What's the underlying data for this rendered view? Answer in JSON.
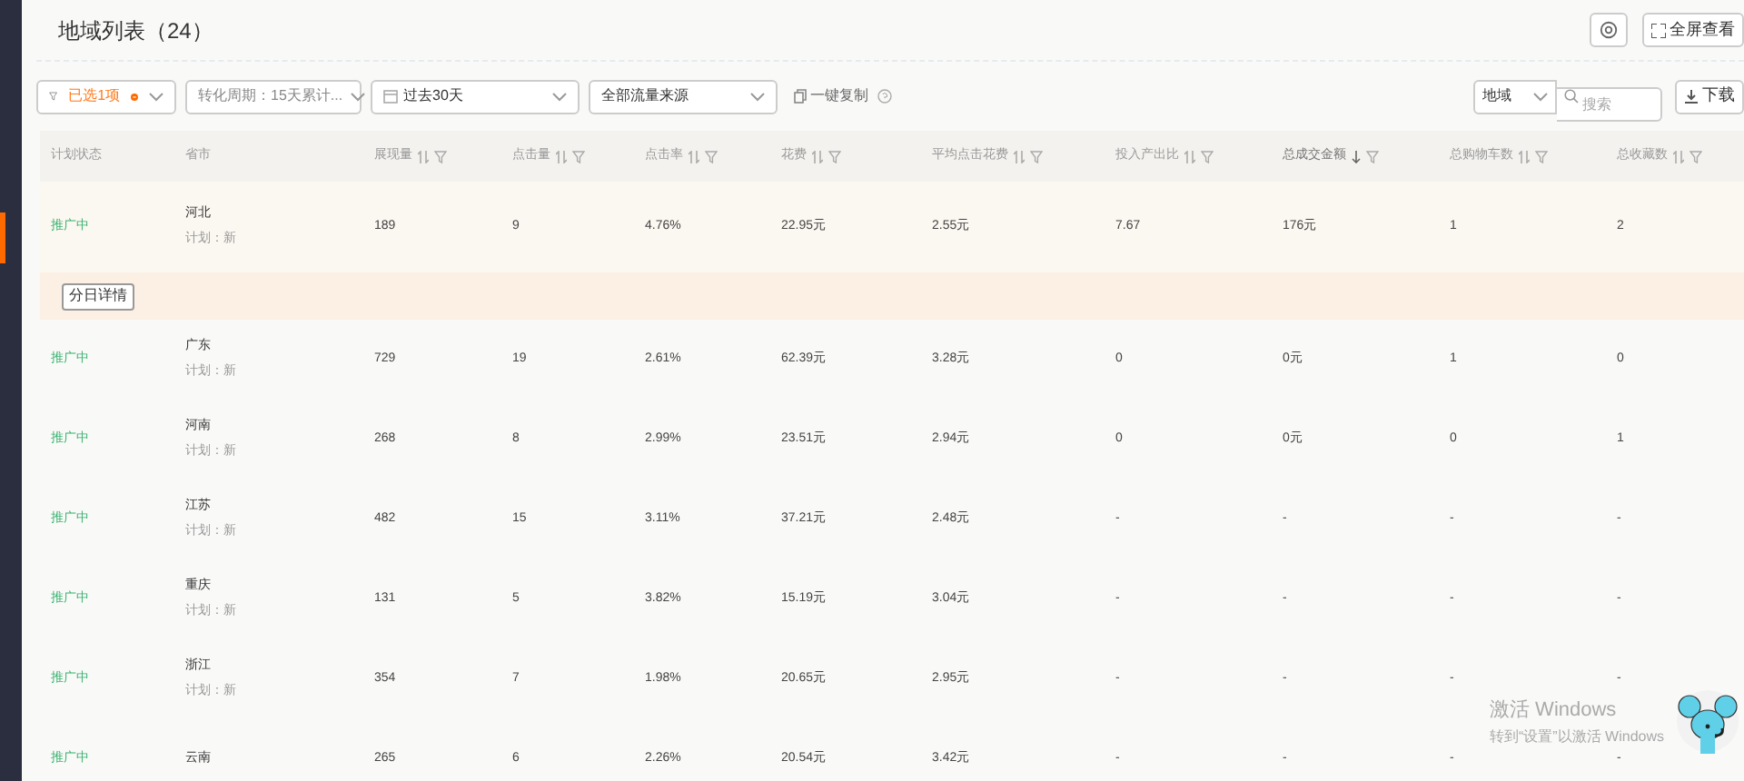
{
  "title": "地域列表（24）",
  "toolbar": {
    "fullscreen": "全屏查看",
    "download": "下载",
    "region_select": "地域",
    "search": {
      "placeholder": "搜索"
    }
  },
  "filters": [
    {
      "kind": "filter",
      "label": "已选1项",
      "badge": true
    },
    {
      "kind": "select",
      "label": "转化周期：15天累计..."
    },
    {
      "kind": "date",
      "label": "过去30天"
    },
    {
      "kind": "select",
      "label": "全部流量来源"
    },
    {
      "kind": "copy",
      "label": "一键复制"
    }
  ],
  "columns": [
    {
      "label": "计划状态",
      "sortable": false,
      "sorted_descending": false,
      "filter": false
    },
    {
      "label": "省市",
      "sortable": false,
      "sorted_descending": false,
      "filter": false
    },
    {
      "label": "展现量",
      "sortable": true,
      "sorted_descending": false,
      "filter": true
    },
    {
      "label": "点击量",
      "sortable": true,
      "sorted_descending": false,
      "filter": true
    },
    {
      "label": "点击率",
      "sortable": true,
      "sorted_descending": false,
      "filter": true
    },
    {
      "label": "花费",
      "sortable": true,
      "sorted_descending": false,
      "filter": true
    },
    {
      "label": "平均点击花费",
      "sortable": true,
      "sorted_descending": false,
      "filter": true
    },
    {
      "label": "投入产出比",
      "sortable": true,
      "sorted_descending": false,
      "filter": true
    },
    {
      "label": "总成交金额",
      "sortable": true,
      "sorted_descending": true,
      "filter": true
    },
    {
      "label": "总购物车数",
      "sortable": true,
      "sorted_descending": false,
      "filter": true
    },
    {
      "label": "总收藏数",
      "sortable": true,
      "sorted_descending": false,
      "filter": true
    }
  ],
  "rows": [
    {
      "status": "推广中",
      "region": "河北",
      "plan": "计划：新",
      "cells": [
        "189",
        "9",
        "4.76%",
        "22.95元",
        "2.55元",
        "7.67",
        "176元",
        "1",
        "2"
      ],
      "selected": true,
      "expanded": true,
      "detail_button": "分日详情"
    },
    {
      "status": "推广中",
      "region": "广东",
      "plan": "计划：新",
      "cells": [
        "729",
        "19",
        "2.61%",
        "62.39元",
        "3.28元",
        "0",
        "0元",
        "1",
        "0"
      ],
      "selected": false,
      "expanded": false
    },
    {
      "status": "推广中",
      "region": "河南",
      "plan": "计划：新",
      "cells": [
        "268",
        "8",
        "2.99%",
        "23.51元",
        "2.94元",
        "0",
        "0元",
        "0",
        "1"
      ],
      "selected": false,
      "expanded": false
    },
    {
      "status": "推广中",
      "region": "江苏",
      "plan": "计划：新",
      "cells": [
        "482",
        "15",
        "3.11%",
        "37.21元",
        "2.48元",
        "-",
        "-",
        "-",
        "-"
      ],
      "selected": false,
      "expanded": false
    },
    {
      "status": "推广中",
      "region": "重庆",
      "plan": "计划：新",
      "cells": [
        "131",
        "5",
        "3.82%",
        "15.19元",
        "3.04元",
        "-",
        "-",
        "-",
        "-"
      ],
      "selected": false,
      "expanded": false
    },
    {
      "status": "推广中",
      "region": "浙江",
      "plan": "计划：新",
      "cells": [
        "354",
        "7",
        "1.98%",
        "20.65元",
        "2.95元",
        "-",
        "-",
        "-",
        "-"
      ],
      "selected": false,
      "expanded": false
    },
    {
      "status": "推广中",
      "region": "云南",
      "cells": [
        "265",
        "6",
        "2.26%",
        "20.54元",
        "3.42元",
        "-",
        "-",
        "-",
        "-"
      ],
      "selected": false,
      "expanded": false
    }
  ],
  "os_notice": {
    "title": "激活 Windows",
    "text": "转到“设置”以激活 Windows"
  }
}
